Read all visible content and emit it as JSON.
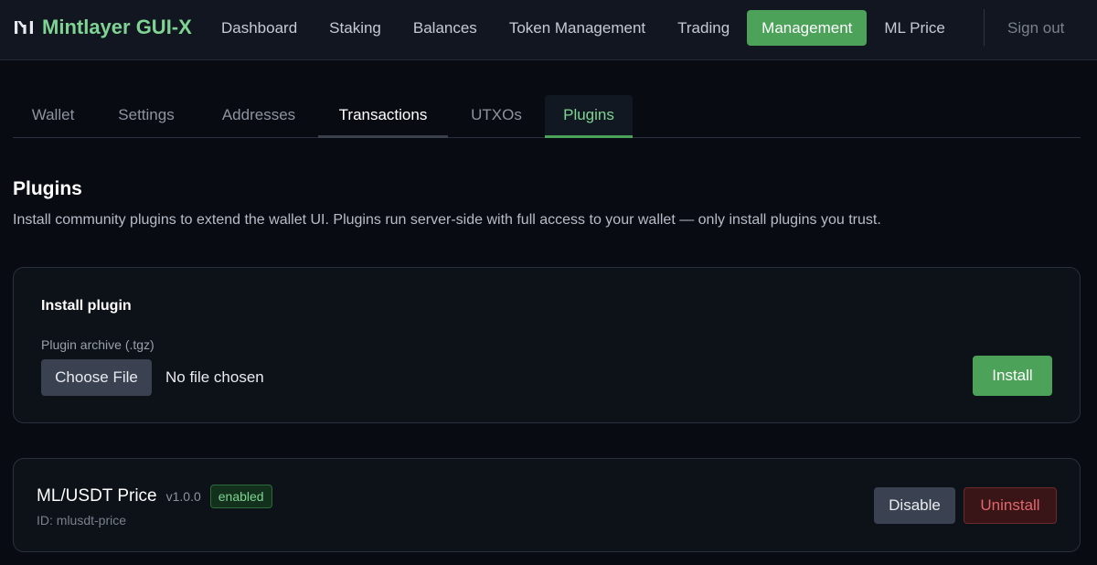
{
  "header": {
    "app_name": "Mintlayer GUI-X",
    "logo_icon": "mintlayer-logo-icon",
    "nav": [
      {
        "label": "Dashboard",
        "active": false
      },
      {
        "label": "Staking",
        "active": false
      },
      {
        "label": "Balances",
        "active": false
      },
      {
        "label": "Token Management",
        "active": false
      },
      {
        "label": "Trading",
        "active": false
      },
      {
        "label": "Management",
        "active": true
      },
      {
        "label": "ML Price",
        "active": false
      }
    ],
    "sign_out": "Sign out"
  },
  "tabs": [
    {
      "label": "Wallet"
    },
    {
      "label": "Settings"
    },
    {
      "label": "Addresses"
    },
    {
      "label": "Transactions"
    },
    {
      "label": "UTXOs"
    },
    {
      "label": "Plugins",
      "selected": true
    }
  ],
  "main": {
    "title": "Plugins",
    "description": "Install community plugins to extend the wallet UI. Plugins run server-side with full access to your wallet — only install plugins you trust.",
    "install_card": {
      "title": "Install plugin",
      "field_label": "Plugin archive (.tgz)",
      "choose_file_label": "Choose File",
      "file_status": "No file chosen",
      "install_label": "Install"
    },
    "plugins": [
      {
        "name": "ML/USDT Price",
        "version": "v1.0.0",
        "status": "enabled",
        "id_text": "ID: mlusdt-price",
        "disable_label": "Disable",
        "uninstall_label": "Uninstall"
      }
    ]
  },
  "colors": {
    "accent": "#4ba258",
    "accent_text": "#7fd493",
    "background": "#080b12",
    "danger": "#e0676b"
  }
}
